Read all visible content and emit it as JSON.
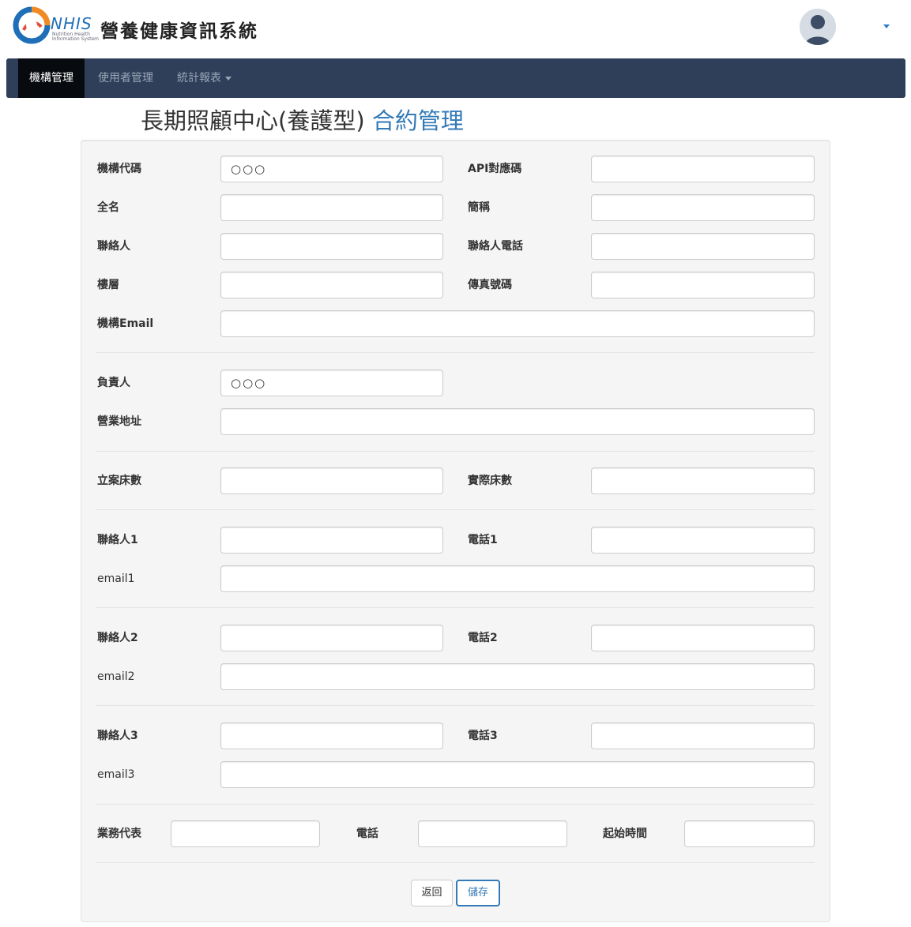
{
  "header": {
    "logo_text": "NHIS",
    "logo_sub": "Nutrition Health Information System",
    "site_title": "營養健康資訊系統"
  },
  "colors": {
    "navbar_bg": "#2f3f5a",
    "nav_active_bg": "#070a0f",
    "accent": "#337ab7",
    "panel_bg": "#f5f5f5"
  },
  "nav": {
    "items": [
      {
        "label": "機構管理",
        "active": true
      },
      {
        "label": "使用者管理",
        "active": false
      },
      {
        "label": "統計報表",
        "active": false,
        "dropdown": true
      }
    ]
  },
  "page": {
    "title_main": "長期照顧中心(養護型)",
    "title_accent": "合約管理"
  },
  "form": {
    "org_code": {
      "label": "機構代碼",
      "value": "○○○"
    },
    "api_code": {
      "label": "API對應碼",
      "value": ""
    },
    "full_name": {
      "label": "全名",
      "value": ""
    },
    "short_name": {
      "label": "簡稱",
      "value": ""
    },
    "contact": {
      "label": "聯絡人",
      "value": ""
    },
    "contact_phone": {
      "label": "聯絡人電話",
      "value": ""
    },
    "floor": {
      "label": "樓層",
      "value": ""
    },
    "fax": {
      "label": "傳真號碼",
      "value": ""
    },
    "org_email": {
      "label": "機構Email",
      "value": ""
    },
    "responsible": {
      "label": "負責人",
      "value": "○○○"
    },
    "address": {
      "label": "營業地址",
      "value": ""
    },
    "beds_registered": {
      "label": "立案床數",
      "value": ""
    },
    "beds_actual": {
      "label": "實際床數",
      "value": ""
    },
    "contact1": {
      "label": "聯絡人1",
      "value": ""
    },
    "phone1": {
      "label": "電話1",
      "value": ""
    },
    "email1": {
      "label": "email1",
      "value": ""
    },
    "contact2": {
      "label": "聯絡人2",
      "value": ""
    },
    "phone2": {
      "label": "電話2",
      "value": ""
    },
    "email2": {
      "label": "email2",
      "value": ""
    },
    "contact3": {
      "label": "聯絡人3",
      "value": ""
    },
    "phone3": {
      "label": "電話3",
      "value": ""
    },
    "email3": {
      "label": "email3",
      "value": ""
    },
    "sales_rep": {
      "label": "業務代表",
      "value": ""
    },
    "phone": {
      "label": "電話",
      "value": ""
    },
    "start_time": {
      "label": "起始時間",
      "value": ""
    }
  },
  "buttons": {
    "back": "返回",
    "save": "儲存"
  }
}
